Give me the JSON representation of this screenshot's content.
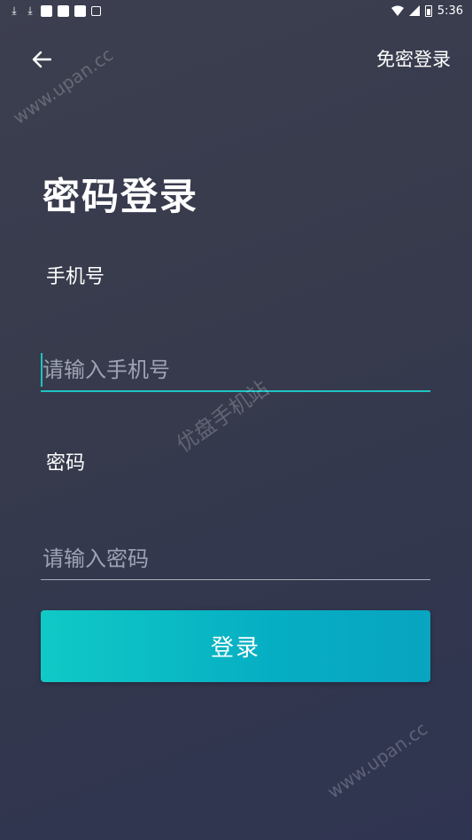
{
  "status_bar": {
    "time": "5:36"
  },
  "header": {
    "back_icon": "arrow-left-icon",
    "passwordless_login": "免密登录"
  },
  "title": "密码登录",
  "phone": {
    "label": "手机号",
    "placeholder": "请输入手机号",
    "value": ""
  },
  "password": {
    "label": "密码",
    "placeholder": "请输入密码",
    "value": ""
  },
  "login_button": "登录",
  "watermarks": {
    "top": "www.upan.cc",
    "middle": "优盘手机站",
    "bottom": "www.upan.cc"
  },
  "colors": {
    "accent": "#1fc3c3",
    "button_start": "#10c9c6",
    "button_end": "#08a4c0"
  }
}
